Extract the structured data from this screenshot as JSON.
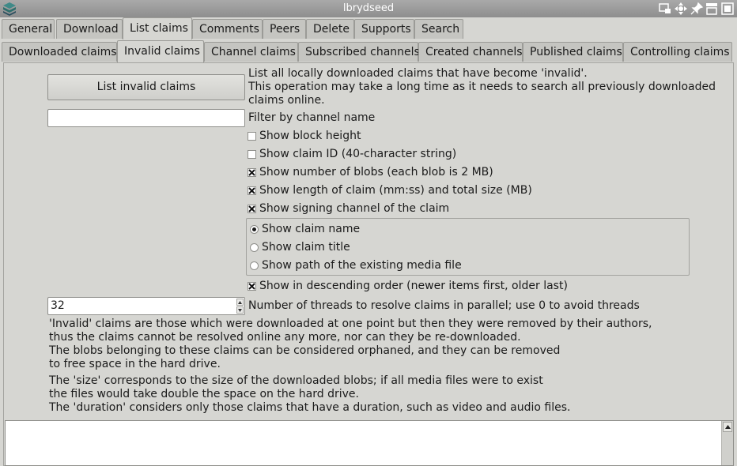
{
  "window": {
    "title": "lbrydseed"
  },
  "main_tabs": [
    {
      "label": "General"
    },
    {
      "label": "Download"
    },
    {
      "label": "List claims",
      "active": true
    },
    {
      "label": "Comments"
    },
    {
      "label": "Peers"
    },
    {
      "label": "Delete"
    },
    {
      "label": "Supports"
    },
    {
      "label": "Search"
    }
  ],
  "sub_tabs": [
    {
      "label": "Downloaded claims"
    },
    {
      "label": "Invalid claims",
      "active": true
    },
    {
      "label": "Channel claims"
    },
    {
      "label": "Subscribed channels"
    },
    {
      "label": "Created channels"
    },
    {
      "label": "Published claims"
    },
    {
      "label": "Controlling claims"
    }
  ],
  "panel": {
    "list_button_label": "List invalid claims",
    "description": [
      "List all locally downloaded claims that have become 'invalid'.",
      "This operation may take a long time as it needs to search all previously downloaded",
      "claims online."
    ],
    "filter_value": "",
    "filter_label": "Filter by channel name",
    "checkboxes": [
      {
        "label": "Show block height",
        "checked": false
      },
      {
        "label": "Show claim ID (40-character string)",
        "checked": false
      },
      {
        "label": "Show number of blobs (each blob is 2 MB)",
        "checked": true
      },
      {
        "label": "Show length of claim (mm:ss) and total size (MB)",
        "checked": true
      },
      {
        "label": "Show signing channel of the claim",
        "checked": true
      }
    ],
    "radios": [
      {
        "label": "Show claim name",
        "selected": true
      },
      {
        "label": "Show claim title",
        "selected": false
      },
      {
        "label": "Show path of the existing media file",
        "selected": false
      }
    ],
    "descending": {
      "label": "Show in descending order (newer items first, older last)",
      "checked": true
    },
    "threads_value": "32",
    "threads_label": "Number of threads to resolve claims in parallel; use 0 to avoid threads",
    "info1": [
      "'Invalid' claims are those which were downloaded at one point but then they were removed by their authors,",
      "thus the claims cannot be resolved online any more, nor can they be re-downloaded.",
      "The blobs belonging to these claims can be considered orphaned, and they can be removed",
      "to free space in the hard drive."
    ],
    "info2": [
      "The 'size' corresponds to the size of the downloaded blobs; if all media files were to exist",
      "the files would take double the space on the hard drive.",
      "The 'duration' considers only those claims that have a duration, such as video and audio files."
    ],
    "output_text": ""
  }
}
